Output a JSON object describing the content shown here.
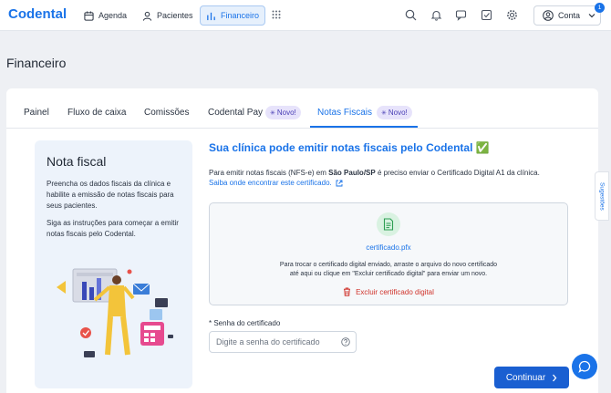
{
  "app": {
    "logo": "Codental"
  },
  "nav": {
    "agenda": "Agenda",
    "pacientes": "Pacientes",
    "financeiro": "Financeiro",
    "account": "Conta",
    "notification_count": "1"
  },
  "page": {
    "title": "Financeiro"
  },
  "tabs": [
    {
      "label": "Painel"
    },
    {
      "label": "Fluxo de caixa"
    },
    {
      "label": "Comissões"
    },
    {
      "label": "Codental Pay",
      "badge": "Novo!"
    },
    {
      "label": "Notas Fiscais",
      "badge": "Novo!",
      "active": true
    }
  ],
  "sidebar": {
    "title": "Nota fiscal",
    "text1": "Preencha os dados fiscais da clínica e habilite a emissão de notas fiscais para seus pacientes.",
    "text2": "Siga as instruções para começar a emitir notas fiscais pelo Codental."
  },
  "main": {
    "title": "Sua clínica pode emitir notas fiscais pelo Codental ✅",
    "desc_prefix": "Para emitir notas fiscais (NFS-e) em ",
    "desc_city": "São Paulo/SP",
    "desc_suffix": " é preciso enviar o Certificado Digital A1 da clínica.",
    "link": "Saiba onde encontrar este certificado."
  },
  "certificate": {
    "filename": "certificado.pfx",
    "help_line1": "Para trocar o certificado digital enviado, arraste o arquivo do novo certificado",
    "help_line2": "até aqui ou clique em \"Excluir certificado digital\" para enviar um novo.",
    "delete_label": "Excluir certificado digital"
  },
  "password": {
    "label": "* Senha do certificado",
    "placeholder": "Digite a senha do certificado"
  },
  "actions": {
    "continue": "Continuar"
  },
  "feedback": {
    "label": "Sugestões"
  },
  "colors": {
    "accent": "#1a73e8",
    "danger": "#d0342c",
    "badge_bg": "#e7e3fb",
    "panel_bg": "#edf3fb"
  }
}
